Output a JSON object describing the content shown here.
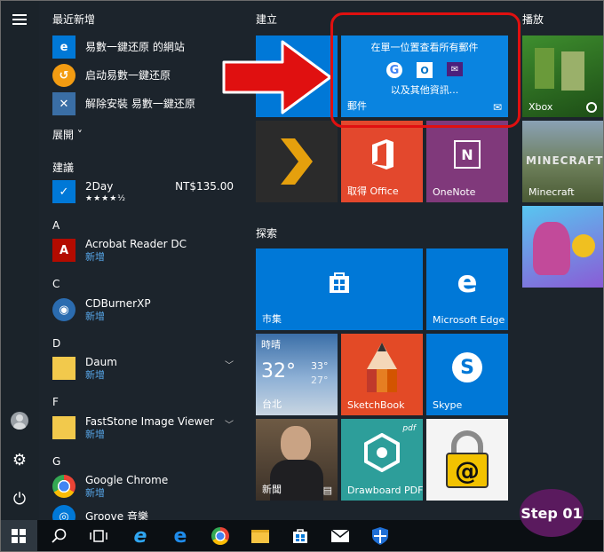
{
  "rail": {
    "icons": [
      "hamburger-icon",
      "user-icon",
      "gear-icon",
      "power-icon"
    ]
  },
  "applist": {
    "recent_header": "最近新增",
    "recent": [
      {
        "name": "易數一鍵还原 的網站",
        "icon": "web-icon"
      },
      {
        "name": "启动易數一鍵还原",
        "icon": "restore-icon"
      },
      {
        "name": "解除安裝 易數一鍵还原",
        "icon": "uninstall-icon"
      }
    ],
    "expand_label": "展開 ˅",
    "suggested_header": "建議",
    "suggested": {
      "name": "2Day",
      "rating": "★★★★½",
      "price": "NT$135.00"
    },
    "groups": [
      {
        "letter": "A",
        "apps": [
          {
            "name": "Acrobat Reader DC",
            "sub": "新增"
          }
        ]
      },
      {
        "letter": "C",
        "apps": [
          {
            "name": "CDBurnerXP",
            "sub": "新增"
          }
        ]
      },
      {
        "letter": "D",
        "apps": [
          {
            "name": "Daum",
            "sub": "新增"
          }
        ]
      },
      {
        "letter": "F",
        "apps": [
          {
            "name": "FastStone Image Viewer",
            "sub": "新增"
          }
        ]
      },
      {
        "letter": "G",
        "apps": [
          {
            "name": "Google Chrome",
            "sub": "新增"
          },
          {
            "name": "Groove 音樂",
            "sub": ""
          }
        ]
      }
    ]
  },
  "tiles": {
    "group_build": "建立",
    "group_play": "播放",
    "group_explore": "探索",
    "mail": {
      "title": "在單一位置查看所有郵件",
      "subtitle": "以及其他資訊...",
      "label": "郵件",
      "services": [
        "google-icon",
        "outlook-icon",
        "yahoo-mail-icon"
      ]
    },
    "xbox": "Xbox",
    "minecraft": "Minecraft",
    "minecraft_logo": "MINECRAFT",
    "get_office": "取得 Office",
    "onenote": "OneNote",
    "store": "市集",
    "edge": "Microsoft Edge",
    "weather": {
      "label": "時晴",
      "temp": "32°",
      "high": "33°",
      "low": "27°",
      "city": "台北"
    },
    "sketchbook": "SketchBook",
    "skype": "Skype",
    "news": "新聞",
    "drawboard": "Drawboard PDF",
    "pdf_tag": "pdf"
  },
  "taskbar": {
    "icons": [
      "windows-start-icon",
      "search-icon",
      "task-view-icon",
      "internet-explorer-icon",
      "edge-icon",
      "chrome-icon",
      "file-explorer-icon",
      "store-icon",
      "mail-icon",
      "defender-icon"
    ]
  },
  "annotation": {
    "step": "Step 01"
  },
  "colors": {
    "tile_blue": "#0078d7",
    "office_red": "#e3482d",
    "onenote_purple": "#80397b",
    "annotation_red": "#e01010",
    "step_purple": "#5a1a5e"
  }
}
